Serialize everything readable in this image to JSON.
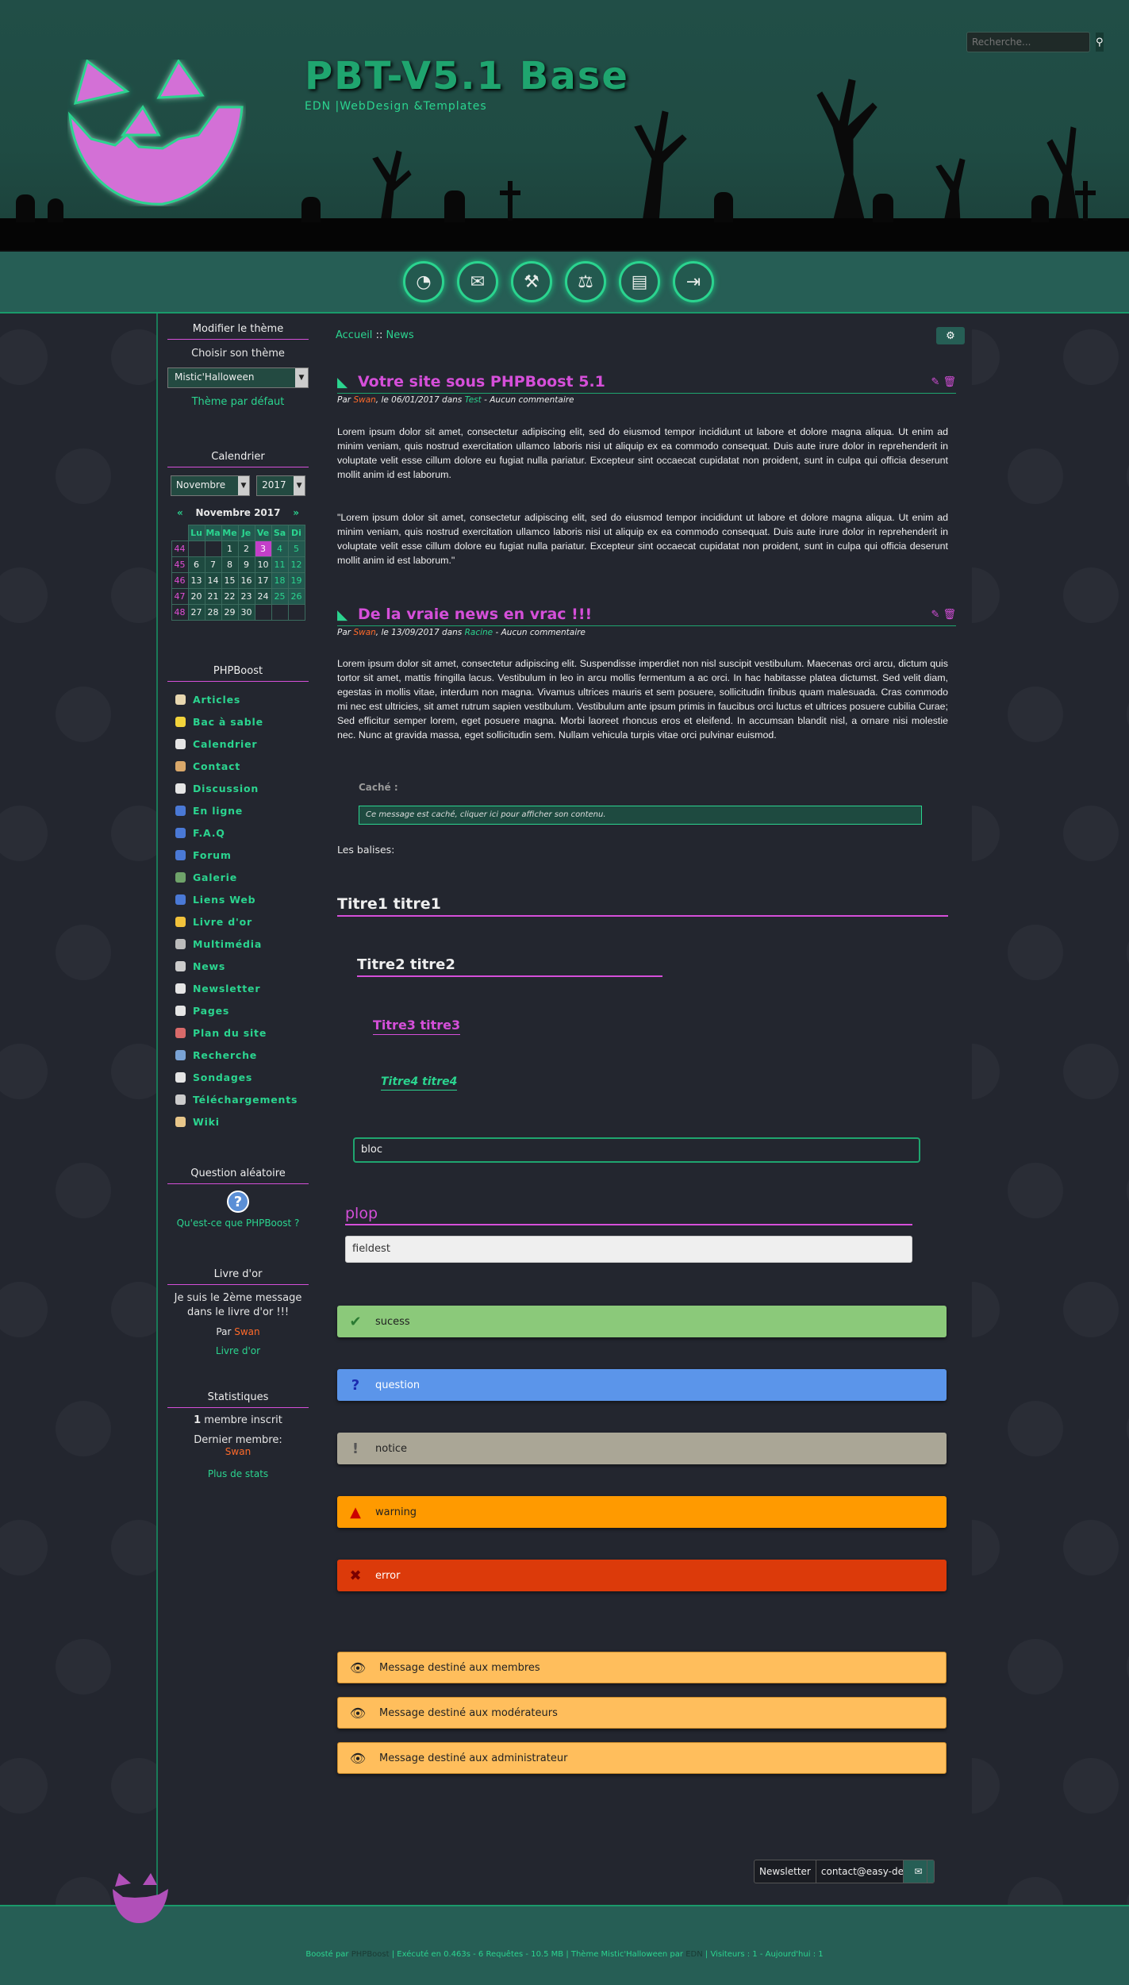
{
  "header": {
    "title": "PBT-V5.1 Base",
    "subtitle": "EDN |WebDesign &Templates",
    "search_placeholder": "Recherche..."
  },
  "nav": {
    "buttons": [
      {
        "name": "dashboard-icon",
        "glyph": "◔"
      },
      {
        "name": "mail-icon",
        "glyph": "✉"
      },
      {
        "name": "wrench-icon",
        "glyph": "🔧"
      },
      {
        "name": "gavel-icon",
        "glyph": "🔨"
      },
      {
        "name": "document-icon",
        "glyph": "▤"
      },
      {
        "name": "logout-icon",
        "glyph": "⇥"
      }
    ]
  },
  "sidebar": {
    "theme": {
      "title": "Modifier le thème",
      "choose": "Choisir son thème",
      "selected": "Mistic'Halloween",
      "default_link": "Thème par défaut"
    },
    "calendar": {
      "title": "Calendrier",
      "month": "Novembre",
      "year": "2017",
      "header": "Novembre 2017",
      "days": [
        "Lu",
        "Ma",
        "Me",
        "Je",
        "Ve",
        "Sa",
        "Di"
      ],
      "weeks": [
        {
          "wk": "44",
          "d": [
            "",
            "",
            "1",
            "2",
            "3",
            "4",
            "5"
          ]
        },
        {
          "wk": "45",
          "d": [
            "6",
            "7",
            "8",
            "9",
            "10",
            "11",
            "12"
          ]
        },
        {
          "wk": "46",
          "d": [
            "13",
            "14",
            "15",
            "16",
            "17",
            "18",
            "19"
          ]
        },
        {
          "wk": "47",
          "d": [
            "20",
            "21",
            "22",
            "23",
            "24",
            "25",
            "26"
          ]
        },
        {
          "wk": "48",
          "d": [
            "27",
            "28",
            "29",
            "30",
            "",
            "",
            ""
          ]
        }
      ],
      "today": "3"
    },
    "phpboost": {
      "title": "PHPBoost",
      "items": [
        {
          "label": "Articles",
          "color": "#e8d7b0"
        },
        {
          "label": "Bac à sable",
          "color": "#f2d33b"
        },
        {
          "label": "Calendrier",
          "color": "#e5e5e5"
        },
        {
          "label": "Contact",
          "color": "#d9a86a"
        },
        {
          "label": "Discussion",
          "color": "#e5e5e5"
        },
        {
          "label": "En ligne",
          "color": "#4a79d6"
        },
        {
          "label": "F.A.Q",
          "color": "#4a79d6"
        },
        {
          "label": "Forum",
          "color": "#4a79d6"
        },
        {
          "label": "Galerie",
          "color": "#6fa36a"
        },
        {
          "label": "Liens Web",
          "color": "#4a79d6"
        },
        {
          "label": "Livre d'or",
          "color": "#f2c23b"
        },
        {
          "label": "Multimédia",
          "color": "#bbbbbb"
        },
        {
          "label": "News",
          "color": "#cccccc"
        },
        {
          "label": "Newsletter",
          "color": "#e5e5e5"
        },
        {
          "label": "Pages",
          "color": "#e5e5e5"
        },
        {
          "label": "Plan du site",
          "color": "#d96a6a"
        },
        {
          "label": "Recherche",
          "color": "#7aa3d6"
        },
        {
          "label": "Sondages",
          "color": "#e5e5e5"
        },
        {
          "label": "Téléchargements",
          "color": "#cccccc"
        },
        {
          "label": "Wiki",
          "color": "#e8c68a"
        }
      ]
    },
    "question": {
      "title": "Question aléatoire",
      "link": "Qu'est-ce que PHPBoost ?"
    },
    "guestbook": {
      "title": "Livre d'or",
      "message": "Je suis le 2ème message dans le livre d'or !!!",
      "by": "Par",
      "author": "Swan",
      "link": "Livre d'or"
    },
    "stats": {
      "title": "Statistiques",
      "members_count": "1",
      "members_label": "membre inscrit",
      "last_member_label": "Dernier membre:",
      "last_member": "Swan",
      "more": "Plus de stats"
    }
  },
  "main": {
    "breadcrumb": {
      "home": "Accueil",
      "sep": "::",
      "current": "News"
    },
    "news": [
      {
        "title": "Votre site sous PHPBoost 5.1",
        "meta_by": "Par",
        "author": "Swan",
        "meta_date": ", le 06/01/2017 dans",
        "category": "Test",
        "meta_comments": " - Aucun commentaire",
        "p1": "Lorem ipsum dolor sit amet, consectetur adipiscing elit, sed do eiusmod tempor incididunt ut labore et dolore magna aliqua. Ut enim ad minim veniam, quis nostrud exercitation ullamco laboris nisi ut aliquip ex ea commodo consequat. Duis aute irure dolor in reprehenderit in voluptate velit esse cillum dolore eu fugiat nulla pariatur. Excepteur sint occaecat cupidatat non proident, sunt in culpa qui officia deserunt mollit anim id est laborum.",
        "p2": "\"Lorem ipsum dolor sit amet, consectetur adipiscing elit, sed do eiusmod tempor incididunt ut labore et dolore magna aliqua. Ut enim ad minim veniam, quis nostrud exercitation ullamco laboris nisi ut aliquip ex ea commodo consequat. Duis aute irure dolor in reprehenderit in voluptate velit esse cillum dolore eu fugiat nulla pariatur. Excepteur sint occaecat cupidatat non proident, sunt in culpa qui officia deserunt mollit anim id est laborum.\""
      },
      {
        "title": "De la vraie news en vrac !!!",
        "meta_by": "Par",
        "author": "Swan",
        "meta_date": ", le 13/09/2017 dans",
        "category": "Racine",
        "meta_comments": " - Aucun commentaire",
        "p1": "Lorem ipsum dolor sit amet, consectetur adipiscing elit. Suspendisse imperdiet non nisl suscipit vestibulum. Maecenas orci arcu, dictum quis tortor sit amet, mattis fringilla lacus. Vestibulum in leo in arcu mollis fermentum a ac orci. In hac habitasse platea dictumst. Sed velit diam, egestas in mollis vitae, interdum non magna. Vivamus ultrices mauris et sem posuere, sollicitudin finibus quam malesuada. Cras commodo mi nec est ultricies, sit amet rutrum sapien vestibulum. Vestibulum ante ipsum primis in faucibus orci luctus et ultrices posuere cubilia Curae; Sed efficitur semper lorem, eget posuere magna. Morbi laoreet rhoncus eros et eleifend. In accumsan blandit nisl, a ornare nisi molestie nec. Nunc at gravida massa, eget sollicitudin sem. Nullam vehicula turpis vitae orci pulvinar euismod."
      }
    ],
    "hidden": {
      "label": "Caché :",
      "text": "Ce message est caché, cliquer ici pour afficher son contenu."
    },
    "tags_label": "Les balises:",
    "h1": "Titre1 titre1",
    "h2": "Titre2 titre2",
    "h3": "Titre3 titre3",
    "h4": "Titre4 titre4",
    "bloc": "bloc",
    "plop": "plop",
    "fieldset": "fieldest",
    "alerts": {
      "success": "sucess",
      "question": "question",
      "notice": "notice",
      "warning": "warning",
      "error": "error"
    },
    "restricted": {
      "members": "Message destiné aux membres",
      "moderators": "Message destiné aux modérateurs",
      "admins": "Message destiné aux administrateur"
    },
    "newsletter": {
      "label": "Newsletter",
      "email": "contact@easy-de"
    }
  },
  "footer": {
    "boost": "Boosté par",
    "phpboost": "PHPBoost",
    "exec": "| Exécuté en 0.463s - 6 Requêtes - 10.5 MB | Thème Mistic'Halloween par",
    "author": "EDN",
    "visitors": "| Visiteurs : 1 - Aujourd'hui : 1"
  }
}
